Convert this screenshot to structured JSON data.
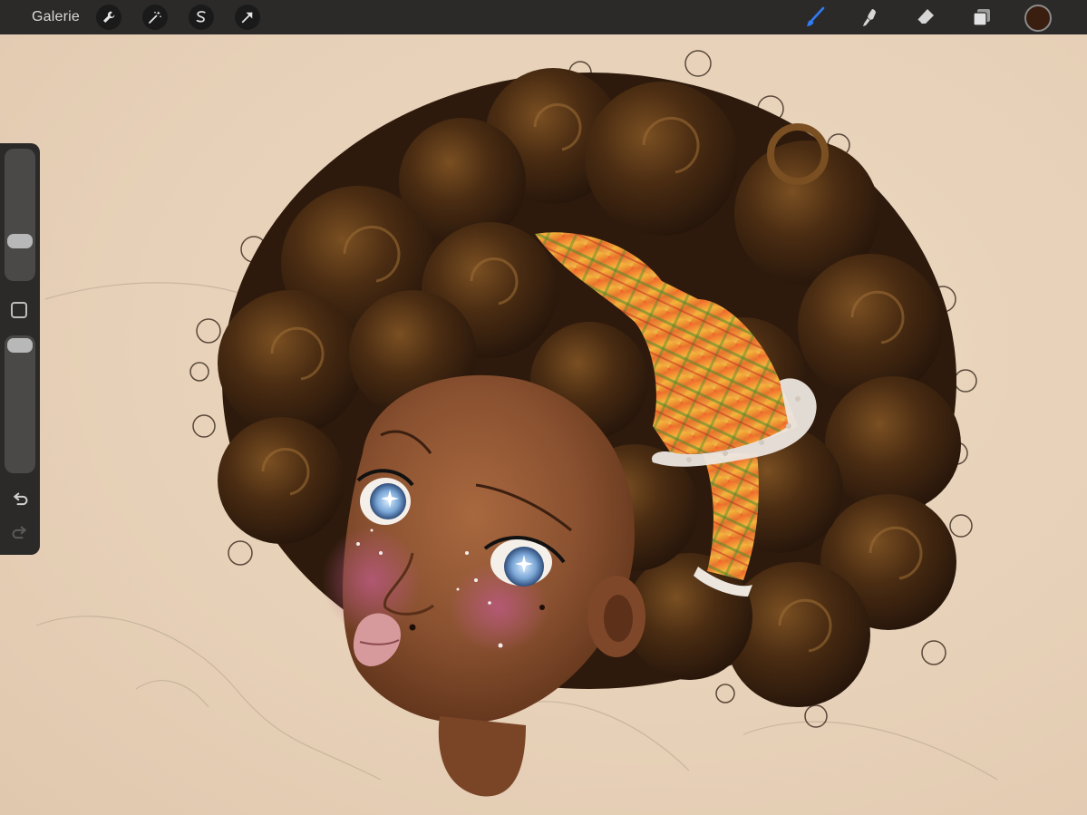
{
  "app": {
    "gallery_label": "Galerie"
  },
  "toolbar": {
    "left_tools": [
      {
        "name": "wrench-icon"
      },
      {
        "name": "magic-wand-icon"
      },
      {
        "name": "selection-icon"
      },
      {
        "name": "transform-arrow-icon"
      }
    ],
    "right_tools": [
      {
        "name": "brush-icon",
        "active": true
      },
      {
        "name": "smudge-icon"
      },
      {
        "name": "eraser-icon"
      },
      {
        "name": "layers-icon"
      }
    ],
    "active_color": "#3a1f10",
    "accent_color": "#2f7cf6"
  },
  "sidebar": {
    "brush_size_level": 0.27,
    "opacity_level": 1.0,
    "icons": [
      "modify-square-icon",
      "undo-icon",
      "redo-icon"
    ]
  },
  "colors": {
    "toolbar_bg": "#2b2a29",
    "canvas_bg": "#e8d3bb",
    "hair": "#3b2413",
    "skin": "#8a5130",
    "bow": "#e98a2a"
  }
}
